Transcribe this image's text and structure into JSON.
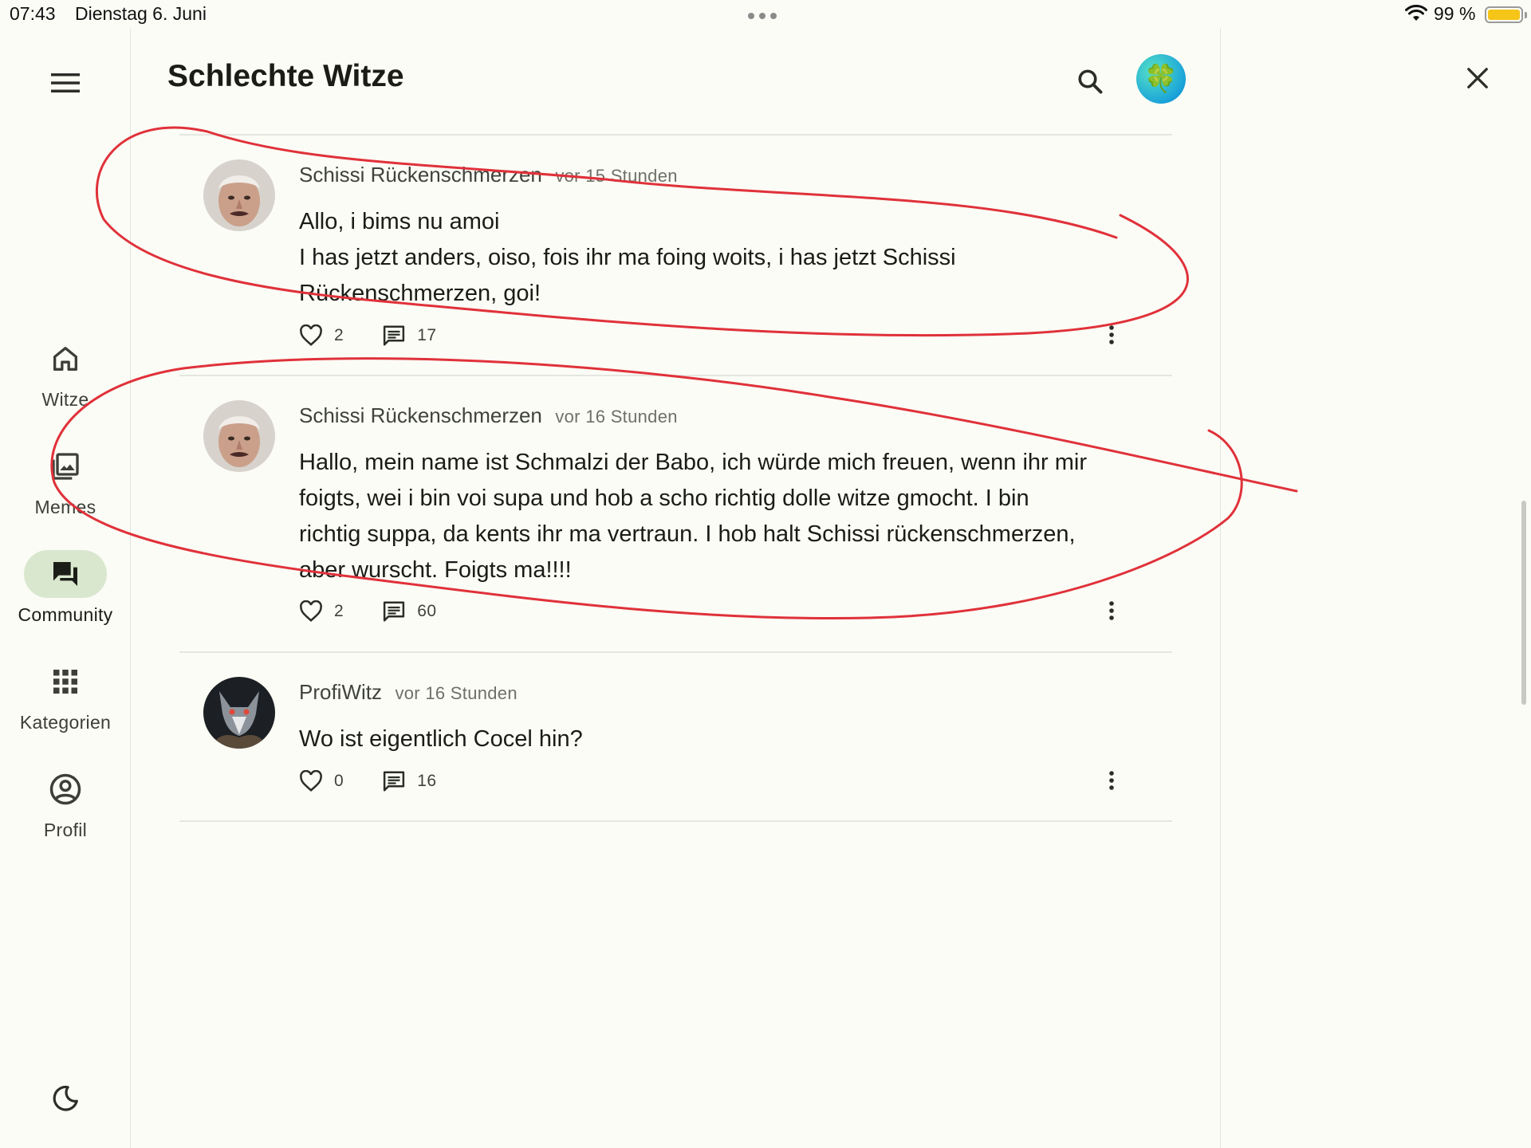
{
  "status_bar": {
    "time": "07:43",
    "date": "Dienstag 6. Juni",
    "battery": "99 %",
    "battery_color": "#f5c518"
  },
  "nav": {
    "menu_icon": "menu-icon",
    "items": [
      {
        "label": "Witze",
        "icon": "home-icon",
        "active": false
      },
      {
        "label": "Memes",
        "icon": "image-icon",
        "active": false
      },
      {
        "label": "Community",
        "icon": "forum-icon",
        "active": true
      },
      {
        "label": "Kategorien",
        "icon": "grid-icon",
        "active": false
      },
      {
        "label": "Profil",
        "icon": "account-circle-icon",
        "active": false
      }
    ],
    "theme_icon": "moon-icon",
    "active_pill_color": "#d9e7cf"
  },
  "header": {
    "title": "Schlechte Witze",
    "search_icon": "search-icon",
    "avatar_glyph": "🍀"
  },
  "posts": [
    {
      "author": "Schissi Rückenschmerzen",
      "time": "vor 15 Stunden",
      "lines": [
        "Allo, i bims nu amoi",
        "I has jetzt anders, oiso, fois ihr ma foing woits, i has jetzt Schissi",
        "Rückenschmerzen, goi!"
      ],
      "likes": "2",
      "comments": "17"
    },
    {
      "author": "Schissi Rückenschmerzen",
      "time": "vor 16 Stunden",
      "lines": [
        "Hallo, mein name ist Schmalzi der Babo, ich würde mich freuen, wenn ihr mir",
        "foigts, wei i bin voi supa und hob a scho richtig dolle witze gmocht. I bin",
        "richtig suppa, da kents ihr ma vertraun. I hob halt Schissi rückenschmerzen,",
        "aber wurscht. Foigts ma!!!!"
      ],
      "likes": "2",
      "comments": "60"
    },
    {
      "author": "ProfiWitz",
      "time": "vor 16 Stunden",
      "lines": [
        "Wo ist eigentlich Cocel hin?"
      ],
      "likes": "0",
      "comments": "16"
    }
  ],
  "close_icon": "close-icon",
  "annotation_color": "#e0313a"
}
